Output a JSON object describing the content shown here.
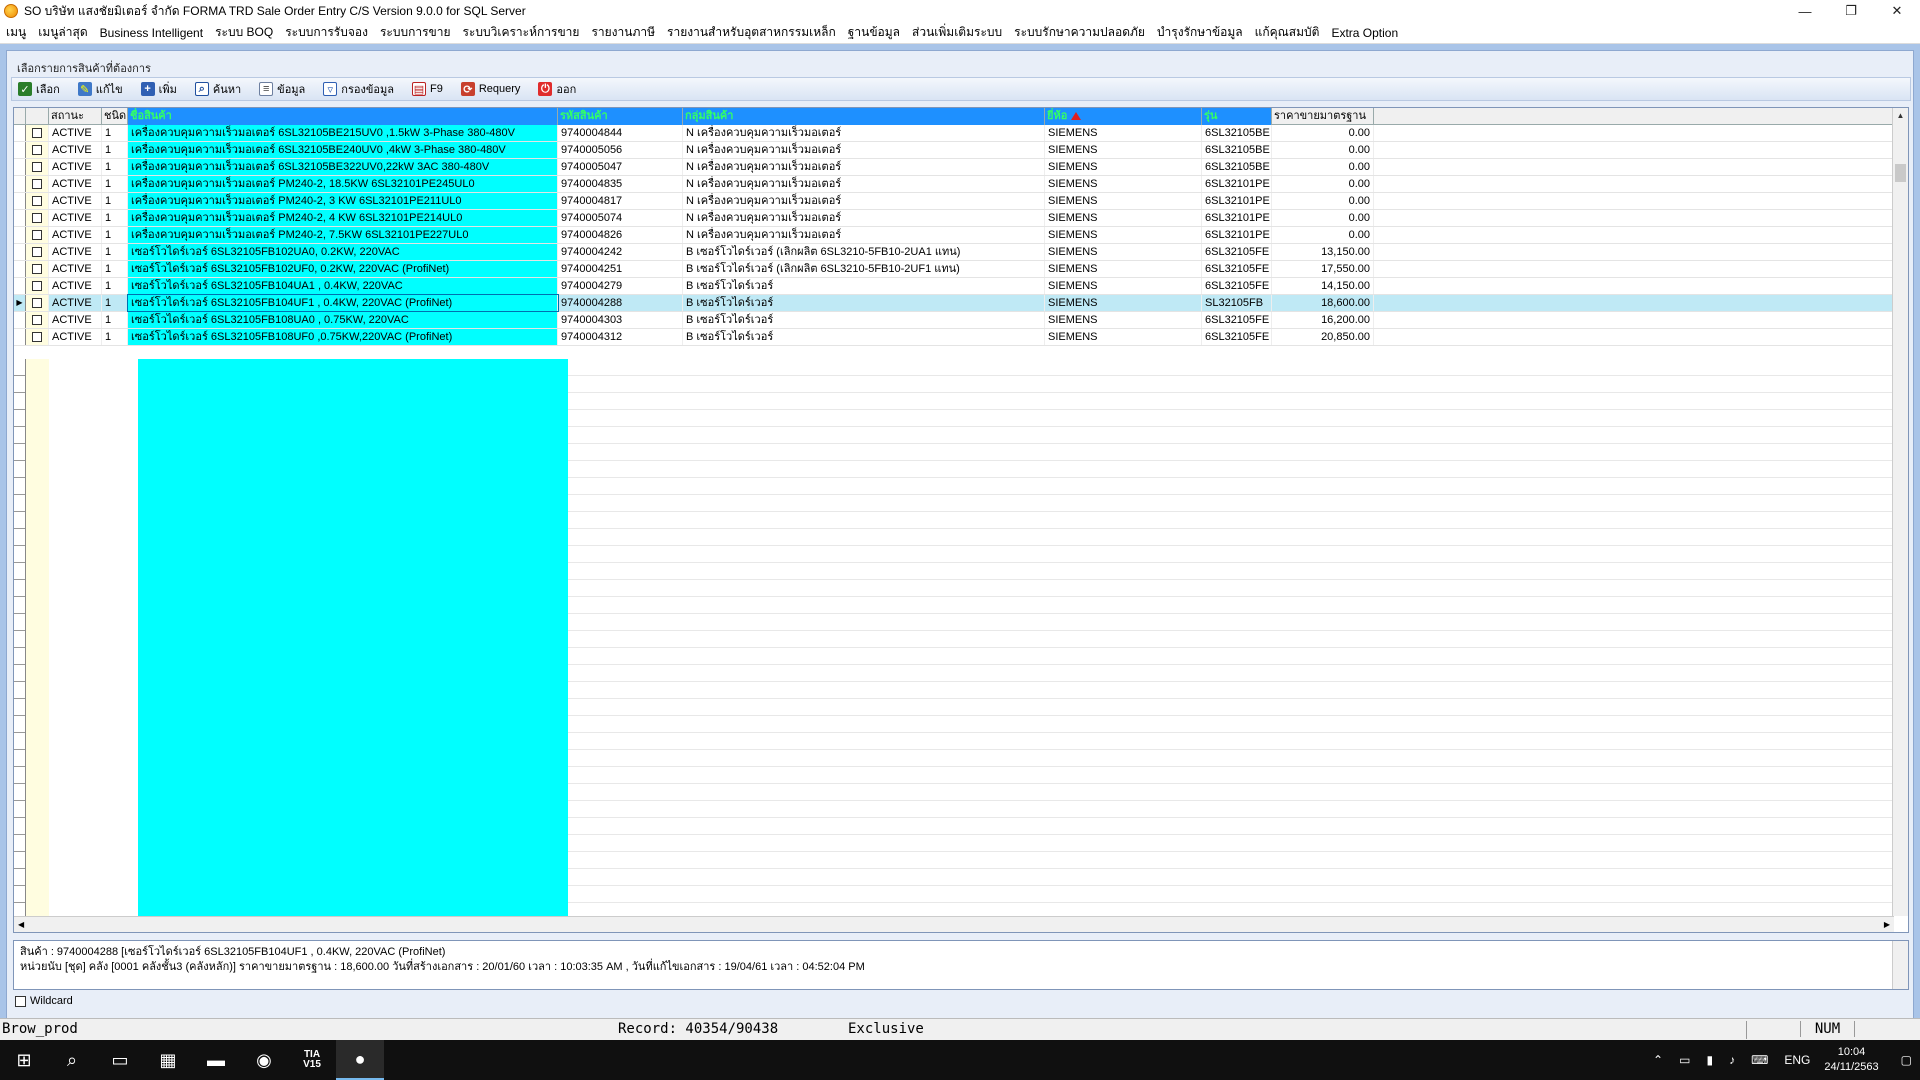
{
  "window": {
    "title": "SO บริษัท แสงชัยมิเตอร์ จำกัด FORMA TRD Sale Order Entry C/S Version 9.0.0 for SQL Server",
    "minimize": "—",
    "restore": "❐",
    "close": "✕"
  },
  "menu": [
    "เมนู",
    "เมนูล่าสุด",
    "Business Intelligent",
    "ระบบ BOQ",
    "ระบบการรับจอง",
    "ระบบการขาย",
    "ระบบวิเคราะห์การขาย",
    "รายงานภาษี",
    "รายงานสำหรับอุตสาหกรรมเหล็ก",
    "ฐานข้อมูล",
    "ส่วนเพิ่มเติมระบบ",
    "ระบบรักษาความปลอดภัย",
    "บำรุงรักษาข้อมูล",
    "แก้คุณสมบัติ",
    "Extra Option"
  ],
  "panel_title": "เลือกรายการสินค้าที่ต้องการ",
  "toolbar": {
    "select": "เลือก",
    "edit": "แก้ไข",
    "add": "เพิ่ม",
    "search": "ค้นหา",
    "info": "ข้อมูล",
    "filter": "กรองข้อมูล",
    "f9": "F9",
    "requery": "Requery",
    "exit": "ออก"
  },
  "grid": {
    "headers": {
      "status": "สถานะ",
      "type": "ชนิด",
      "name": "ชื่อสินค้า",
      "code": "รหัสสินค้า",
      "group": "กลุ่มสินค้า",
      "brand": "ยี่ห้อ",
      "model": "รุ่น",
      "price": "ราคาขายมาตรฐาน"
    },
    "rows": [
      {
        "status": "ACTIVE",
        "type": "1",
        "name": "เครื่องควบคุมความเร็วมอเตอร์ 6SL32105BE215UV0 ,1.5kW 3-Phase 380-480V",
        "code": "9740004844",
        "group": "N เครื่องควบคุมความเร็วมอเตอร์",
        "brand": "SIEMENS",
        "model": "6SL32105BE",
        "price": "0.00"
      },
      {
        "status": "ACTIVE",
        "type": "1",
        "name": "เครื่องควบคุมความเร็วมอเตอร์ 6SL32105BE240UV0 ,4kW 3-Phase 380-480V",
        "code": "9740005056",
        "group": "N เครื่องควบคุมความเร็วมอเตอร์",
        "brand": "SIEMENS",
        "model": "6SL32105BE",
        "price": "0.00"
      },
      {
        "status": "ACTIVE",
        "type": "1",
        "name": "เครื่องควบคุมความเร็วมอเตอร์ 6SL32105BE322UV0,22kW 3AC 380-480V",
        "code": "9740005047",
        "group": "N เครื่องควบคุมความเร็วมอเตอร์",
        "brand": "SIEMENS",
        "model": "6SL32105BE",
        "price": "0.00"
      },
      {
        "status": "ACTIVE",
        "type": "1",
        "name": "เครื่องควบคุมความเร็วมอเตอร์ PM240-2, 18.5KW 6SL32101PE245UL0",
        "code": "9740004835",
        "group": "N เครื่องควบคุมความเร็วมอเตอร์",
        "brand": "SIEMENS",
        "model": "6SL32101PE",
        "price": "0.00"
      },
      {
        "status": "ACTIVE",
        "type": "1",
        "name": "เครื่องควบคุมความเร็วมอเตอร์ PM240-2, 3 KW 6SL32101PE211UL0",
        "code": "9740004817",
        "group": "N เครื่องควบคุมความเร็วมอเตอร์",
        "brand": "SIEMENS",
        "model": "6SL32101PE",
        "price": "0.00"
      },
      {
        "status": "ACTIVE",
        "type": "1",
        "name": "เครื่องควบคุมความเร็วมอเตอร์ PM240-2, 4 KW 6SL32101PE214UL0",
        "code": "9740005074",
        "group": "N เครื่องควบคุมความเร็วมอเตอร์",
        "brand": "SIEMENS",
        "model": "6SL32101PE",
        "price": "0.00"
      },
      {
        "status": "ACTIVE",
        "type": "1",
        "name": "เครื่องควบคุมความเร็วมอเตอร์ PM240-2, 7.5KW 6SL32101PE227UL0",
        "code": "9740004826",
        "group": "N เครื่องควบคุมความเร็วมอเตอร์",
        "brand": "SIEMENS",
        "model": "6SL32101PE",
        "price": "0.00"
      },
      {
        "status": "ACTIVE",
        "type": "1",
        "name": "เซอร์โวไดร์เวอร์ 6SL32105FB102UA0, 0.2KW, 220VAC",
        "code": "9740004242",
        "group": "B เซอร์โวไดร์เวอร์ (เลิกผลิต 6SL3210-5FB10-2UA1 แทน)",
        "brand": "SIEMENS",
        "model": "6SL32105FE",
        "price": "13,150.00"
      },
      {
        "status": "ACTIVE",
        "type": "1",
        "name": "เซอร์โวไดร์เวอร์ 6SL32105FB102UF0, 0.2KW, 220VAC (ProfiNet)",
        "code": "9740004251",
        "group": "B เซอร์โวไดร์เวอร์ (เลิกผลิต 6SL3210-5FB10-2UF1 แทน)",
        "brand": "SIEMENS",
        "model": "6SL32105FE",
        "price": "17,550.00"
      },
      {
        "status": "ACTIVE",
        "type": "1",
        "name": "เซอร์โวไดร์เวอร์ 6SL32105FB104UA1 , 0.4KW, 220VAC",
        "code": "9740004279",
        "group": "B เซอร์โวไดร์เวอร์",
        "brand": "SIEMENS",
        "model": "6SL32105FE",
        "price": "14,150.00"
      },
      {
        "status": "ACTIVE",
        "type": "1",
        "name": "เซอร์โวไดร์เวอร์ 6SL32105FB104UF1 , 0.4KW, 220VAC (ProfiNet)",
        "code": "9740004288",
        "group": "B เซอร์โวไดร์เวอร์",
        "brand": "SIEMENS",
        "model": "SL32105FB",
        "price": "18,600.00",
        "selected": true
      },
      {
        "status": "ACTIVE",
        "type": "1",
        "name": "เซอร์โวไดร์เวอร์ 6SL32105FB108UA0 , 0.75KW, 220VAC",
        "code": "9740004303",
        "group": "B เซอร์โวไดร์เวอร์",
        "brand": "SIEMENS",
        "model": "6SL32105FE",
        "price": "16,200.00"
      },
      {
        "status": "ACTIVE",
        "type": "1",
        "name": "เซอร์โวไดร์เวอร์ 6SL32105FB108UF0 ,0.75KW,220VAC (ProfiNet)",
        "code": "9740004312",
        "group": "B เซอร์โวไดร์เวอร์",
        "brand": "SIEMENS",
        "model": "6SL32105FE",
        "price": "20,850.00"
      }
    ]
  },
  "detail": {
    "line1": "สินค้า : 9740004288 [เซอร์โวไดร์เวอร์ 6SL32105FB104UF1 , 0.4KW, 220VAC (ProfiNet)",
    "line2": "หน่วยนับ [ชุด] คลัง [0001 คลังชั้น3 (คลังหลัก)] ราคาขายมาตรฐาน : 18,600.00 วันที่สร้างเอกสาร : 20/01/60 เวลา : 10:03:35 AM , วันที่แก้ไขเอกสาร : 19/04/61 เวลา : 04:52:04 PM"
  },
  "wildcard_label": "Wildcard",
  "statusbar": {
    "form": "Brow_prod",
    "record": "Record: 40354/90438",
    "mode": "Exclusive",
    "num": "NUM"
  },
  "taskbar": {
    "tia_line1": "TIA",
    "tia_line2": "V15",
    "lang": "ENG",
    "time": "10:04",
    "date": "24/11/2563"
  },
  "colors": {
    "name_column": "#00ffff",
    "header_highlight": "#1e90ff",
    "selected_row": "#bfe9f5"
  }
}
